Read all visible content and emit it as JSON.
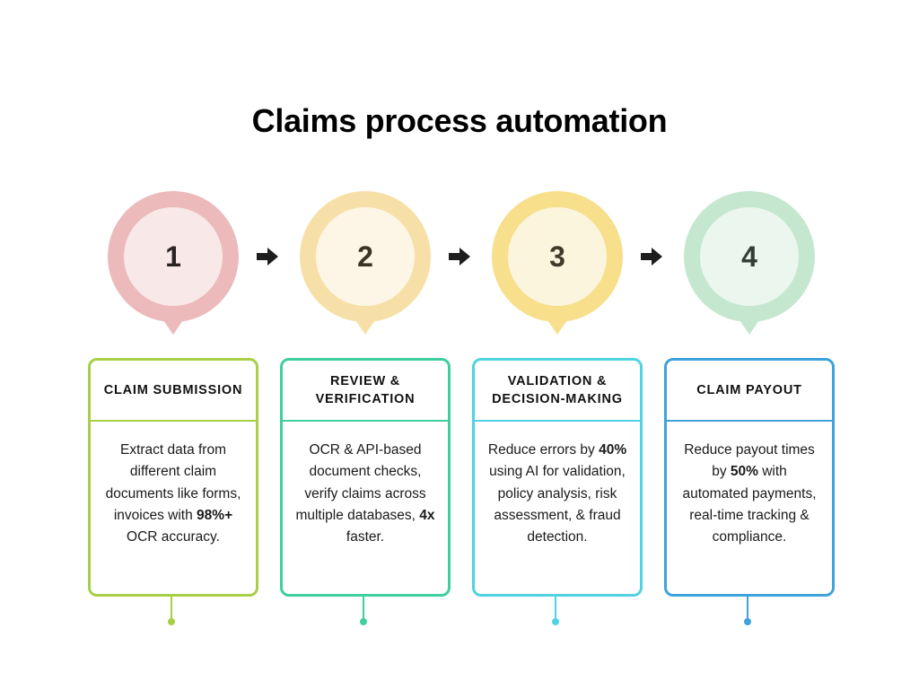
{
  "title": "Claims process automation",
  "arrow_icon": "right-arrow-icon",
  "steps": [
    {
      "number": "1",
      "heading": "CLAIM SUBMISSION",
      "body_parts": [
        {
          "text": "Extract data from different claim documents like forms, invoices with ",
          "bold": false
        },
        {
          "text": "98%+",
          "bold": true
        },
        {
          "text": " OCR accuracy.",
          "bold": false
        }
      ],
      "colors": {
        "outer": "#ecbaba",
        "inner": "#f8e8e8",
        "number": "#2b2323",
        "border": "#a8cf45"
      }
    },
    {
      "number": "2",
      "heading": "REVIEW & VERIFICATION",
      "body_parts": [
        {
          "text": "OCR & API-based document checks, verify claims across multiple databases, ",
          "bold": false
        },
        {
          "text": "4x",
          "bold": true
        },
        {
          "text": " faster.",
          "bold": false
        }
      ],
      "colors": {
        "outer": "#f7e0a8",
        "inner": "#fdf6e6",
        "number": "#3a3326",
        "border": "#3fcf9e"
      }
    },
    {
      "number": "3",
      "heading": "VALIDATION & DECISION-MAKING",
      "body_parts": [
        {
          "text": "Reduce errors by ",
          "bold": false
        },
        {
          "text": "40%",
          "bold": true
        },
        {
          "text": " using AI for validation, policy analysis, risk assessment, & fraud detection.",
          "bold": false
        }
      ],
      "colors": {
        "outer": "#f7df8c",
        "inner": "#fcf5de",
        "number": "#3f3a2a",
        "border": "#4fd3e3"
      }
    },
    {
      "number": "4",
      "heading": "CLAIM PAYOUT",
      "body_parts": [
        {
          "text": "Reduce payout times by ",
          "bold": false
        },
        {
          "text": "50%",
          "bold": true
        },
        {
          "text": " with automated payments, real-time tracking & compliance.",
          "bold": false
        }
      ],
      "colors": {
        "outer": "#c5e7cf",
        "inner": "#eaf6ee",
        "number": "#333d36",
        "border": "#3ea2dc"
      }
    }
  ]
}
